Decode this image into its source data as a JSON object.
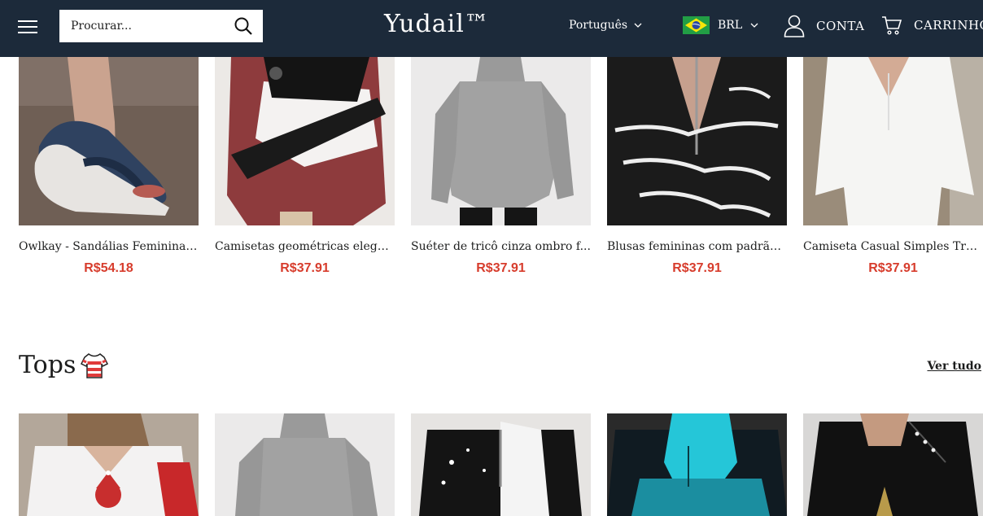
{
  "header": {
    "search_placeholder": "Procurar...",
    "logo": "Yudail™",
    "language": "Português",
    "currency": "BRL",
    "account_label": "CONTA",
    "cart_label": "CARRINHO"
  },
  "products_row1": [
    {
      "title": "Owlkay - Sandálias Femininas...",
      "price": "R$54.18"
    },
    {
      "title": "Camisetas geométricas elega...",
      "price": "R$37.91"
    },
    {
      "title": "Suéter de tricô cinza ombro f...",
      "price": "R$37.91"
    },
    {
      "title": "Blusas femininas com padrão...",
      "price": "R$37.91"
    },
    {
      "title": "Camiseta Casual Simples Trê...",
      "price": "R$37.91"
    }
  ],
  "tops_section": {
    "title": "Tops",
    "view_all": "Ver tudo"
  },
  "colors": {
    "header_bg": "#1c2a3a",
    "price": "#d73c2c"
  }
}
